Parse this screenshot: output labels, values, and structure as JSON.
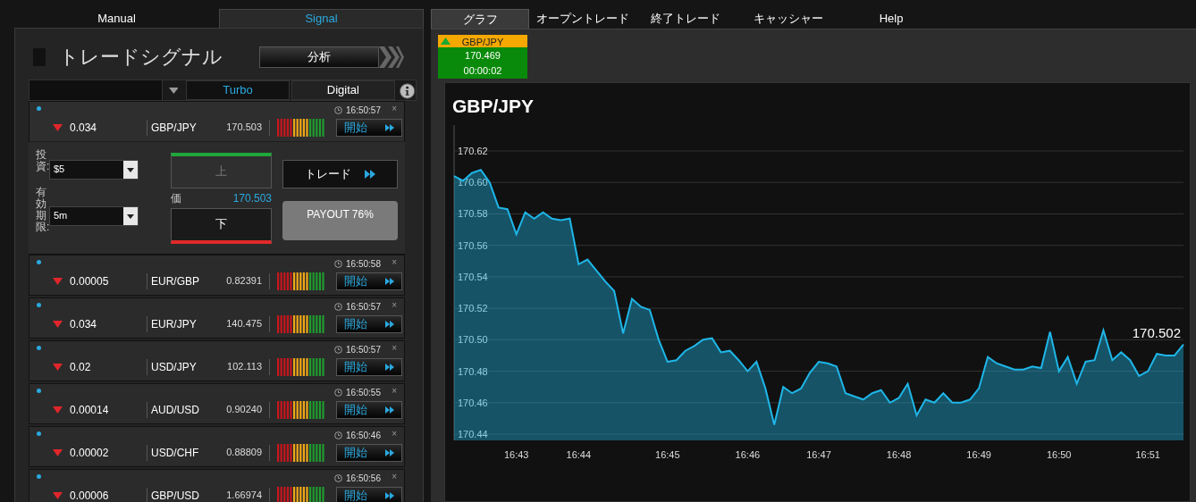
{
  "left_tabs": [
    {
      "label": "Manual",
      "selected": false
    },
    {
      "label": "Signal",
      "selected": true
    }
  ],
  "right_tabs": [
    {
      "label": "グラフ",
      "selected": true
    },
    {
      "label": "オープントレード",
      "selected": false
    },
    {
      "label": "終了トレード",
      "selected": false
    },
    {
      "label": "キャッシャー",
      "selected": false
    },
    {
      "label": "Help",
      "selected": false
    }
  ],
  "signal_panel": {
    "title": "トレードシグナル",
    "analyze_button": "分析",
    "filter_tabs": [
      {
        "label": "Turbo",
        "selected": true
      },
      {
        "label": "Digital",
        "selected": false
      }
    ],
    "signals": [
      {
        "change": "0.034",
        "pair": "GBP/JPY",
        "price": "170.503",
        "time": "16:50:57",
        "close": "×",
        "start": "開始",
        "expanded": true
      },
      {
        "change": "0.00005",
        "pair": "EUR/GBP",
        "price": "0.82391",
        "time": "16:50:58",
        "close": "×",
        "start": "開始",
        "expanded": false
      },
      {
        "change": "0.034",
        "pair": "EUR/JPY",
        "price": "140.475",
        "time": "16:50:57",
        "close": "×",
        "start": "開始",
        "expanded": false
      },
      {
        "change": "0.02",
        "pair": "USD/JPY",
        "price": "102.113",
        "time": "16:50:57",
        "close": "×",
        "start": "開始",
        "expanded": false
      },
      {
        "change": "0.00014",
        "pair": "AUD/USD",
        "price": "0.90240",
        "time": "16:50:55",
        "close": "×",
        "start": "開始",
        "expanded": false
      },
      {
        "change": "0.00002",
        "pair": "USD/CHF",
        "price": "0.88809",
        "time": "16:50:46",
        "close": "×",
        "start": "開始",
        "expanded": false
      },
      {
        "change": "0.00006",
        "pair": "GBP/USD",
        "price": "1.66974",
        "time": "16:50:56",
        "close": "×",
        "start": "開始",
        "expanded": false
      }
    ],
    "trade_form": {
      "investment_label": "投資:",
      "investment_value": "$5",
      "expiry_label": "有効期限:",
      "expiry_value": "5m",
      "up_button": "上",
      "down_button": "下",
      "price_label": "価",
      "price_value": "170.503",
      "trade_button": "トレード",
      "payout": "PAYOUT 76%"
    }
  },
  "ticker": {
    "pair": "GBP/JPY",
    "price": "170.469",
    "timer": "00:00:02"
  },
  "chart": {
    "last_label": "170.502",
    "chart_data": {
      "type": "area",
      "title": "GBP/JPY",
      "grid": true,
      "categories": [
        null,
        null,
        null,
        null,
        null,
        null,
        null,
        "16:43",
        null,
        null,
        null,
        null,
        null,
        null,
        "16:44",
        null,
        null,
        null,
        null,
        null,
        null,
        null,
        null,
        null,
        "16:45",
        null,
        null,
        null,
        null,
        null,
        null,
        null,
        null,
        "16:46",
        null,
        null,
        null,
        null,
        null,
        null,
        null,
        "16:47",
        null,
        null,
        null,
        null,
        null,
        null,
        null,
        null,
        "16:48",
        null,
        null,
        null,
        null,
        null,
        null,
        null,
        null,
        "16:49",
        null,
        null,
        null,
        null,
        null,
        null,
        null,
        null,
        "16:50",
        null,
        null,
        null,
        null,
        null,
        null,
        null,
        null,
        null,
        "16:51",
        null,
        null,
        null,
        null
      ],
      "series": [
        {
          "color": "#1fb6e8",
          "values": [
            170.604,
            170.601,
            170.606,
            170.608,
            170.6,
            170.584,
            170.583,
            170.567,
            170.581,
            170.577,
            170.581,
            170.577,
            170.576,
            170.577,
            170.548,
            170.551,
            170.544,
            170.537,
            170.531,
            170.504,
            170.526,
            170.521,
            170.519,
            170.5,
            170.486,
            170.487,
            170.493,
            170.496,
            170.5,
            170.501,
            170.492,
            170.493,
            170.487,
            170.48,
            170.486,
            170.469,
            170.446,
            170.47,
            170.466,
            170.469,
            170.479,
            170.486,
            170.485,
            170.483,
            170.466,
            170.464,
            170.462,
            170.466,
            170.468,
            170.46,
            170.463,
            170.472,
            170.452,
            170.462,
            170.46,
            170.466,
            170.46,
            170.46,
            170.462,
            170.469,
            170.489,
            170.485,
            170.483,
            170.481,
            170.481,
            170.483,
            170.482,
            170.505,
            170.48,
            170.489,
            170.472,
            170.486,
            170.487,
            170.506,
            170.487,
            170.492,
            170.487,
            170.477,
            170.48,
            170.491,
            170.49,
            170.49,
            170.497
          ]
        }
      ],
      "ylim": [
        170.44,
        170.62
      ],
      "yticks": [
        {
          "value": 170.44,
          "label": "170.44"
        },
        {
          "value": 170.46,
          "label": "170.46"
        },
        {
          "value": 170.48,
          "label": "170.48"
        },
        {
          "value": 170.5,
          "label": "170.50"
        },
        {
          "value": 170.52,
          "label": "170.52"
        },
        {
          "value": 170.54,
          "label": "170.54"
        },
        {
          "value": 170.56,
          "label": "170.56"
        },
        {
          "value": 170.58,
          "label": "170.58"
        },
        {
          "value": 170.6,
          "label": "170.60"
        },
        {
          "value": 170.62,
          "label": "170.62"
        }
      ]
    }
  }
}
